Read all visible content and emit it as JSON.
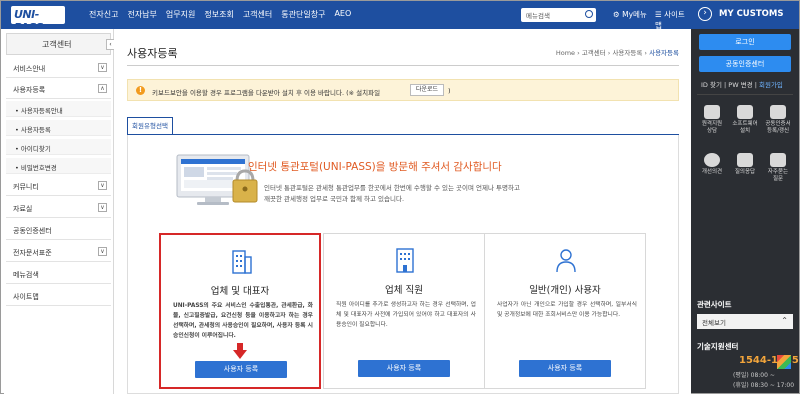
{
  "header": {
    "logo": "UNI-PASS",
    "nav": [
      "전자신고",
      "전자납부",
      "업무지원",
      "정보조회",
      "고객센터",
      "통관단일창구",
      "AEO"
    ],
    "search_placeholder": "메뉴검색",
    "mymenu": "My메뉴",
    "sitemap": "사이트맵"
  },
  "right_panel": {
    "title": "MY CUSTOMS",
    "login_button": "로그인",
    "cert_button": "공동인증센터",
    "links": [
      "ID 찾기",
      "PW 변경",
      "회원가입"
    ],
    "quick_icons": [
      {
        "icon": "remote-support-icon",
        "label": "원격지원\n상담"
      },
      {
        "icon": "software-install-icon",
        "label": "소프트웨어\n설치"
      },
      {
        "icon": "certificate-icon",
        "label": "공동인증서\n등록/갱신"
      },
      {
        "icon": "opinion-icon",
        "label": "개선의견"
      },
      {
        "icon": "qna-icon",
        "label": "질의응답"
      },
      {
        "icon": "faq-icon",
        "label": "자주묻는\n질문"
      }
    ],
    "related_sites_title": "관련사이트",
    "related_sites_select": "전체보기",
    "support_title": "기술지원센터",
    "phone": "1544-1285",
    "hours_weekday": "(평일) 08:00 ~",
    "hours_holiday": "(휴일) 08:30 ~ 17:00"
  },
  "sidebar": {
    "title": "고객센터",
    "items": [
      {
        "label": "서비스안내",
        "toggle": "∨"
      },
      {
        "label": "사용자등록",
        "toggle": "∧"
      },
      {
        "label": "커뮤니티",
        "toggle": "∨"
      },
      {
        "label": "자료실",
        "toggle": "∨"
      },
      {
        "label": "공동인증센터",
        "toggle": ""
      },
      {
        "label": "전자문서표준",
        "toggle": "∨"
      },
      {
        "label": "메뉴검색",
        "toggle": ""
      },
      {
        "label": "사이트맵",
        "toggle": ""
      }
    ],
    "sub_items": [
      "• 사용자등록안내",
      "• 사용자등록",
      "• 아이디찾기",
      "• 비밀번호변경"
    ]
  },
  "main": {
    "title": "사용자등록",
    "breadcrumb": [
      "Home",
      "고객센터",
      "사용자등록",
      "사용자등록"
    ],
    "notice": "키보드보안을 이용할 경우 프로그램을 다운받아 설치 후 이용 바랍니다. (※ 설치파일",
    "notice_button": "다운로드",
    "notice_end": ")",
    "tab": "회원유형선택",
    "hero_title": "인터넷 통관포털(UNI-PASS)을 방문해 주셔서 감사합니다",
    "hero_desc": "인터넷 통관포털은 관세청 통관업무를 한곳에서 한번에 수행할 수 있는 곳이며 언제나 투명하고 깨끗한 관세행정 업무로 국민과 함께 하고 있습니다.",
    "cards": [
      {
        "title": "업체 및 대표자",
        "desc": "UNI-PASS의 주요 서비스인 수출입통관, 관세환급, 화물, 신고필증발급, 요건신청 등을 이용하고자 하는 경우 선택하며, 관세청의 사용승인이 필요하며, 사용자 등록 시 승인신청이 이루어집니다.",
        "button": "사용자 등록"
      },
      {
        "title": "업체 직원",
        "desc": "직원 아이디를 추가로 생성하고자 하는 경우 선택하며, 업체 및 대표자가 사전에 가입되어 있어야 하고 대표자의 사용승인이 필요합니다.",
        "button": "사용자 등록"
      },
      {
        "title": "일반(개인) 사용자",
        "desc": "사업자가 아닌 개인으로 가입할 경우 선택하며, 일부서식 및 공개정보에 대한 조회서비스만 이용 가능합니다.",
        "button": "사용자 등록"
      }
    ]
  },
  "colors": {
    "header_blue": "#1e4fa0",
    "button_blue": "#2e72d2",
    "highlight_red": "#d62828",
    "hero_orange": "#e05a22",
    "panel_dark": "#2b2e33"
  }
}
